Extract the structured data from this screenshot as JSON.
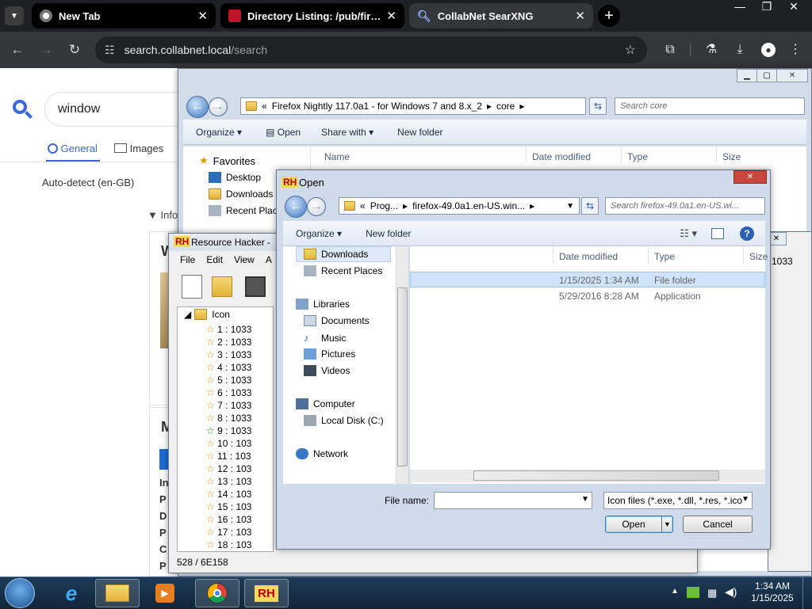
{
  "browser": {
    "tabs": [
      {
        "title": "New Tab",
        "active": false
      },
      {
        "title": "Directory Listing: /pub/firefox",
        "active": false
      },
      {
        "title": "CollabNet SearXNG",
        "active": true
      }
    ],
    "url_host": "search.collabnet.local",
    "url_path": "/search",
    "icons": {
      "tab_list": "chevron-down-icon",
      "close": "close-icon",
      "new_tab": "plus-icon",
      "back": "arrow-left-icon",
      "forward": "arrow-right-icon",
      "reload": "reload-icon",
      "site_info": "tune-icon",
      "bookmark": "star-icon",
      "extensions": "puzzle-icon",
      "labs": "flask-icon",
      "downloads": "download-icon",
      "profile": "person-icon",
      "menu": "kebab-icon",
      "minimize": "minimize-icon",
      "maximize": "maximize-icon"
    }
  },
  "search_page": {
    "query": "window",
    "tabs": {
      "general": "General",
      "images": "Images"
    },
    "language": "Auto-detect (en-GB)",
    "info_label": "Info",
    "side_letters": [
      "W",
      "M"
    ],
    "result_letters": [
      "In",
      "P",
      "D",
      "P",
      "C",
      "P"
    ]
  },
  "explorer": {
    "breadcrumb_prefix": "«",
    "breadcrumb": [
      "Firefox Nightly 117.0a1 - for Windows 7 and 8.x_2",
      "core"
    ],
    "search_placeholder": "Search core",
    "commands": [
      "Organize",
      "Open",
      "Share with",
      "New folder"
    ],
    "nav": [
      "Favorites",
      "Desktop",
      "Downloads",
      "Recent Places"
    ],
    "columns": [
      "Name",
      "Date modified",
      "Type",
      "Size"
    ]
  },
  "resource_hacker": {
    "title": "Resource Hacker - ",
    "menu": [
      "File",
      "Edit",
      "View",
      "A"
    ],
    "tree_root": "Icon",
    "items": [
      "1 : 1033",
      "2 : 1033",
      "3 : 1033",
      "4 : 1033",
      "5 : 1033",
      "6 : 1033",
      "7 : 1033",
      "8 : 1033",
      "9 : 1033",
      "10 : 103",
      "11 : 103",
      "12 : 103",
      "13 : 103",
      "14 : 103",
      "15 : 103",
      "16 : 103",
      "17 : 103",
      "18 : 103"
    ],
    "status": "528 / 6E158",
    "edge_value": "1033"
  },
  "open_dialog": {
    "title": "Open",
    "breadcrumb_prefix": "«",
    "breadcrumb": [
      "Prog...",
      "firefox-49.0a1.en-US.win..."
    ],
    "search_placeholder": "Search firefox-49.0a1.en-US.wi...",
    "commands": [
      "Organize",
      "New folder"
    ],
    "nav": {
      "downloads": "Downloads",
      "recent": "Recent Places",
      "libraries": "Libraries",
      "documents": "Documents",
      "music": "Music",
      "pictures": "Pictures",
      "videos": "Videos",
      "computer": "Computer",
      "local_disk": "Local Disk (C:)",
      "network": "Network"
    },
    "columns": {
      "date": "Date modified",
      "type": "Type",
      "size": "Size"
    },
    "files": [
      {
        "date": "1/15/2025 1:34 AM",
        "type": "File folder"
      },
      {
        "date": "5/29/2016 8:28 AM",
        "type": "Application"
      }
    ],
    "file_name_label": "File name:",
    "file_name_value": "",
    "file_type": "Icon files (*.exe, *.dll, *.res, *.ico",
    "open_label": "Open",
    "cancel_label": "Cancel",
    "close_icon": "close-icon"
  },
  "taskbar": {
    "time": "1:34 AM",
    "date": "1/15/2025",
    "apps": [
      "start-orb-icon",
      "internet-explorer-icon",
      "file-explorer-icon",
      "media-player-icon",
      "chrome-icon",
      "resource-hacker-icon"
    ]
  }
}
